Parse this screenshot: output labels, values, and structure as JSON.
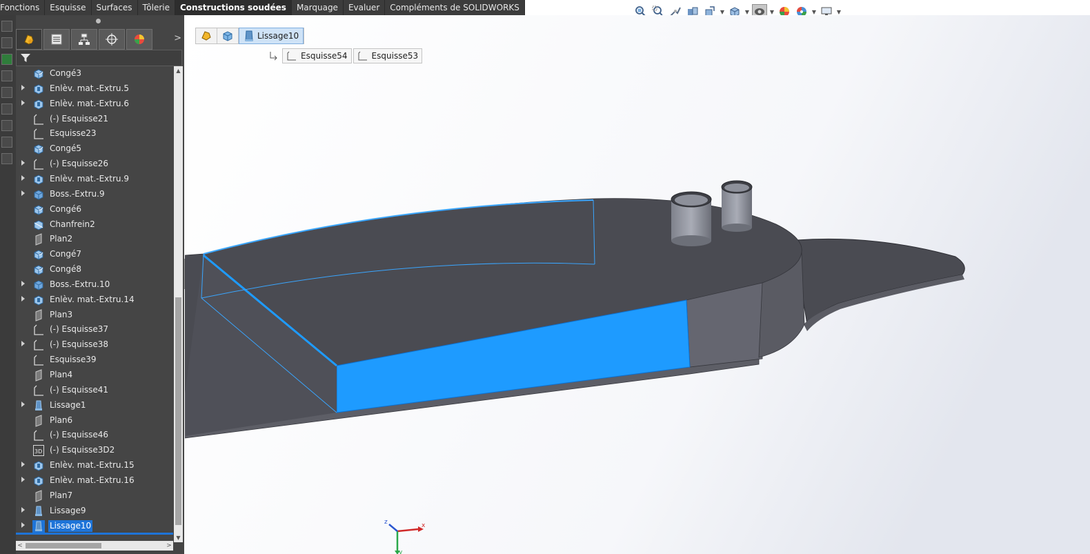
{
  "tabs": [
    {
      "label": "Fonctions",
      "active": false
    },
    {
      "label": "Esquisse",
      "active": false
    },
    {
      "label": "Surfaces",
      "active": false
    },
    {
      "label": "Tôlerie",
      "active": false
    },
    {
      "label": "Constructions soudées",
      "active": true
    },
    {
      "label": "Marquage",
      "active": false
    },
    {
      "label": "Evaluer",
      "active": false
    },
    {
      "label": "Compléments de SOLIDWORKS",
      "active": false
    }
  ],
  "tree": {
    "items": [
      {
        "label": "Congé3",
        "icon": "fillet-icon",
        "expandable": false
      },
      {
        "label": "Enlèv. mat.-Extru.5",
        "icon": "cut-extrude-icon",
        "expandable": true
      },
      {
        "label": "Enlèv. mat.-Extru.6",
        "icon": "cut-extrude-icon",
        "expandable": true
      },
      {
        "label": "(-) Esquisse21",
        "icon": "sketch-icon",
        "expandable": false
      },
      {
        "label": "Esquisse23",
        "icon": "sketch-icon",
        "expandable": false
      },
      {
        "label": "Congé5",
        "icon": "fillet-icon",
        "expandable": false
      },
      {
        "label": "(-) Esquisse26",
        "icon": "sketch-icon",
        "expandable": true
      },
      {
        "label": "Enlèv. mat.-Extru.9",
        "icon": "cut-extrude-icon",
        "expandable": true
      },
      {
        "label": "Boss.-Extru.9",
        "icon": "boss-extrude-icon",
        "expandable": true
      },
      {
        "label": "Congé6",
        "icon": "fillet-icon",
        "expandable": false
      },
      {
        "label": "Chanfrein2",
        "icon": "chamfer-icon",
        "expandable": false
      },
      {
        "label": "Plan2",
        "icon": "plane-icon",
        "expandable": false
      },
      {
        "label": "Congé7",
        "icon": "fillet-icon",
        "expandable": false
      },
      {
        "label": "Congé8",
        "icon": "fillet-icon",
        "expandable": false
      },
      {
        "label": "Boss.-Extru.10",
        "icon": "boss-extrude-icon",
        "expandable": true
      },
      {
        "label": "Enlèv. mat.-Extru.14",
        "icon": "cut-extrude-icon",
        "expandable": true
      },
      {
        "label": "Plan3",
        "icon": "plane-icon",
        "expandable": false
      },
      {
        "label": "(-) Esquisse37",
        "icon": "sketch-icon",
        "expandable": false
      },
      {
        "label": "(-) Esquisse38",
        "icon": "sketch-icon",
        "expandable": true
      },
      {
        "label": "Esquisse39",
        "icon": "sketch-icon",
        "expandable": false
      },
      {
        "label": "Plan4",
        "icon": "plane-icon",
        "expandable": false
      },
      {
        "label": "(-) Esquisse41",
        "icon": "sketch-icon",
        "expandable": false
      },
      {
        "label": "Lissage1",
        "icon": "loft-icon",
        "expandable": true
      },
      {
        "label": "Plan6",
        "icon": "plane-icon",
        "expandable": false
      },
      {
        "label": "(-) Esquisse46",
        "icon": "sketch-icon",
        "expandable": false
      },
      {
        "label": "(-) Esquisse3D2",
        "icon": "sketch3d-icon",
        "expandable": false
      },
      {
        "label": "Enlèv. mat.-Extru.15",
        "icon": "cut-extrude-icon",
        "expandable": true
      },
      {
        "label": "Enlèv. mat.-Extru.16",
        "icon": "cut-extrude-icon",
        "expandable": true
      },
      {
        "label": "Plan7",
        "icon": "plane-icon",
        "expandable": false
      },
      {
        "label": "Lissage9",
        "icon": "loft-icon",
        "expandable": true
      },
      {
        "label": "Lissage10",
        "icon": "loft-icon",
        "expandable": true,
        "selected": true
      }
    ]
  },
  "breadcrumb": {
    "active": "Lissage10",
    "children": [
      "Esquisse54",
      "Esquisse53"
    ]
  },
  "triad": {
    "x": "x",
    "y": "y",
    "z": "z"
  },
  "colors": {
    "selection": "#1e9bff",
    "part": "#4a4b52",
    "panel": "#454545",
    "accent": "#1e74d8"
  }
}
